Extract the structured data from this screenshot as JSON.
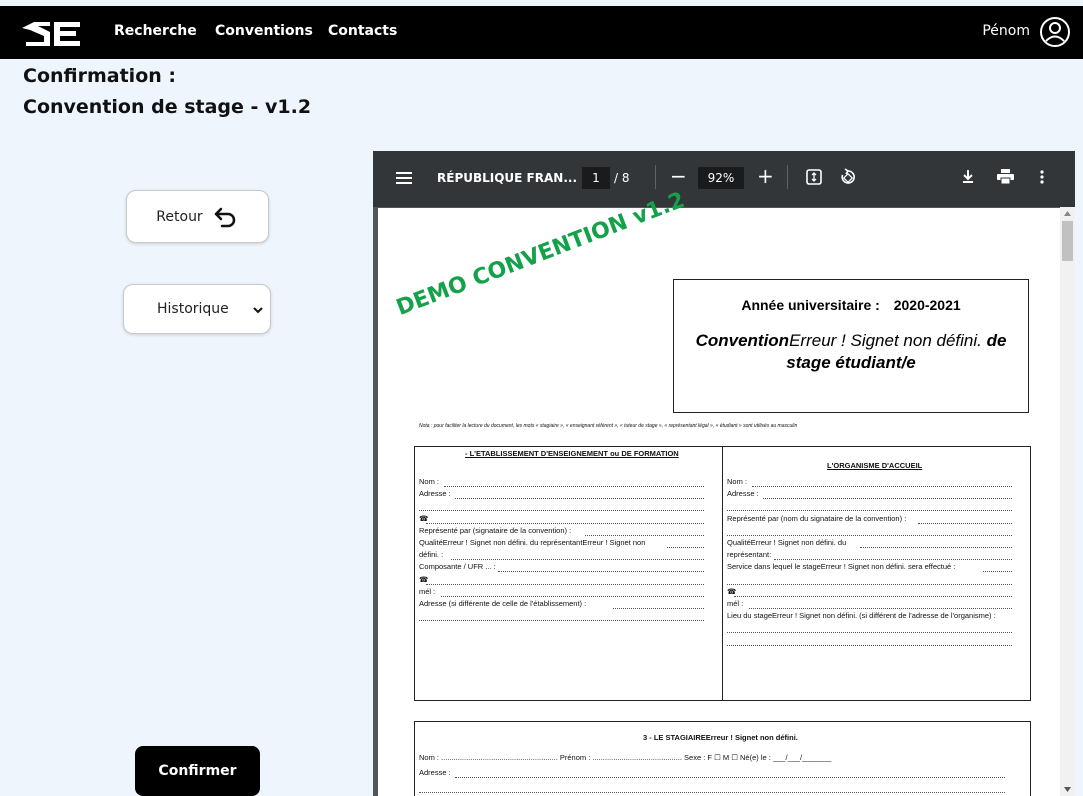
{
  "nav": {
    "recherche": "Recherche",
    "conventions": "Conventions",
    "contacts": "Contacts",
    "user": "Pénom"
  },
  "heading": {
    "line1": "Confirmation :",
    "line2": "Convention de stage - v1.2"
  },
  "buttons": {
    "retour": "Retour",
    "historique": "Historique",
    "confirmer": "Confirmer"
  },
  "viewer": {
    "title": "RÉPUBLIQUE FRAN...",
    "page": "1",
    "pages": "/ 8",
    "zoom": "92%"
  },
  "doc": {
    "watermark": "DEMO CONVENTION v1.2",
    "year_label": "Année universitaire :",
    "year": "2020-2021",
    "title_bold": "Convention",
    "title_err": "Erreur ! Signet non défini.",
    "title_de": " de",
    "title_line2": "stage étudiant/e",
    "note": "Nota : pour faciliter la  lecture du document, les mots « stagiaire », « enseignant  référent », « tuteur de stage », « représentant légal », « étudiant » sont utilisés au masculin",
    "left_header": "- L'ETABLISSEMENT D'ENSEIGNEMENT ou DE FORMATION",
    "left_lines": [
      "Nom  : ",
      "Adresse : ",
      "",
      "☎ ",
      "Représenté par (signataire de la convention) :",
      "QualitéErreur ! Signet non défini. du représentantErreur ! Signet non",
      "défini. :",
      "Composante / UFR ... :",
      "☎ ",
      "mél : ",
      "Adresse (si différente de celle de l'établissement) : ",
      ""
    ],
    "right_header": "L'ORGANISME D'ACCUEIL",
    "right_lines": [
      "Nom  : ",
      "Adresse : ",
      "",
      "Représenté par (nom du signataire de la convention) :",
      "",
      "QualitéErreur ! Signet non défini. du",
      "représentant:",
      "Service dans lequel le stageErreur ! Signet non défini. sera effectué :",
      "",
      "☎ ",
      "mél : ",
      "Lieu du stageErreur ! Signet non défini. (si différent de l'adresse de l'organisme) :",
      "",
      ""
    ],
    "stagiaire_header": "3 - LE STAGIAIREErreur ! Signet non défini.",
    "stagiaire_line1": "Nom : ........................................................ Prénom : ........................................... Sexe  : F ☐  M ☐    Né(e) le : ___/___/_______",
    "stagiaire_line2": "Adresse : "
  }
}
